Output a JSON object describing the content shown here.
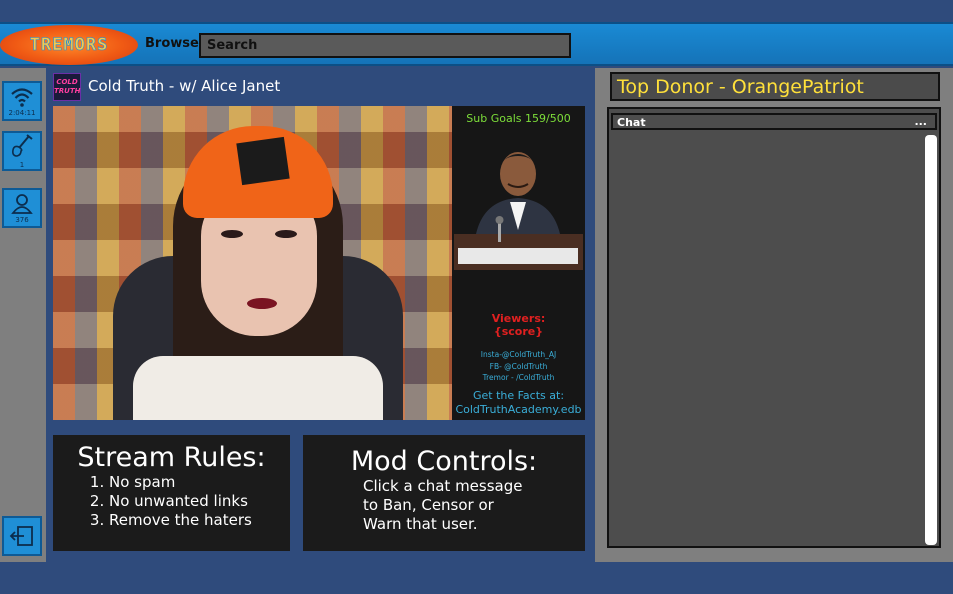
{
  "app": {
    "logo_text": "TREMORS"
  },
  "header": {
    "browse_label": "Browse",
    "search_placeholder": "Search"
  },
  "sidebar": {
    "items": [
      {
        "icon": "signal-icon",
        "caption": "2:04:11"
      },
      {
        "icon": "guitar-icon",
        "caption": "1"
      },
      {
        "icon": "user-icon",
        "caption": "376"
      }
    ],
    "exit_icon": "exit-icon"
  },
  "stream": {
    "channel_icon_text": "COLD TRUTH",
    "title": "Cold Truth - w/ Alice Janet",
    "overlay": {
      "sub_goals": "Sub Goals 159/500",
      "viewers_label": "Viewers:",
      "viewers_value": "{score}",
      "insta": "Insta-@ColdTruth_AJ",
      "fb": "FB- @ColdTruth",
      "tremor": "Tremor - /ColdTruth",
      "facts_line1": "Get the Facts at:",
      "facts_line2": "ColdTruthAcademy.edb"
    }
  },
  "rules": {
    "title": "Stream Rules:",
    "items": [
      "No spam",
      "No unwanted links",
      "Remove the haters"
    ]
  },
  "mods": {
    "title": "Mod Controls:",
    "lines": [
      "Click a chat message",
      "to Ban, Censor or",
      "Warn that user."
    ]
  },
  "donor": {
    "text": "Top Donor - OrangePatriot"
  },
  "chat": {
    "title": "Chat",
    "more": "..."
  },
  "colors": {
    "background": "#2f4b7c",
    "topbar": "#1a8ad4",
    "panel": "#1b1b1b",
    "donor_text": "#ffe03a",
    "sub_goals": "#7dde3a",
    "viewers": "#e02020",
    "links": "#3aaed8"
  }
}
